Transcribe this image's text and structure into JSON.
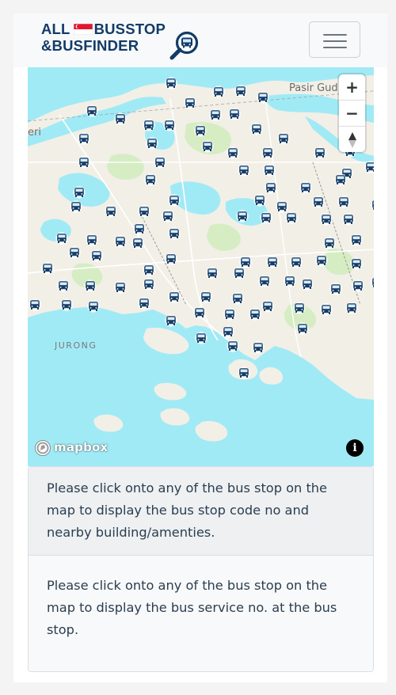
{
  "brand": {
    "line1_a": "ALL",
    "line1_b": "BUSSTOP",
    "line2": "&BUSFINDER",
    "flag_icon": "singapore-flag-icon",
    "logo_icon": "magnifier-bus-icon"
  },
  "navbar": {
    "toggler_icon": "hamburger-menu-icon"
  },
  "map": {
    "labels": {
      "pasir": "Pasir Gud",
      "eri": "eri",
      "jurong": "JURONG"
    },
    "controls": {
      "zoom_in": "+",
      "zoom_out": "−"
    },
    "attribution": "mapbox",
    "info": "i"
  },
  "panels": {
    "stop_info": "Please click onto any of the bus stop on the map to display the bus stop code no and nearby building/amenties.",
    "service_info": "Please click onto any of the bus stop on the map to display the bus service no. at the bus stop."
  },
  "colors": {
    "brand": "#123b68",
    "water": "#a0eaf6",
    "land": "#f2efe7",
    "park": "#d6edc4"
  }
}
